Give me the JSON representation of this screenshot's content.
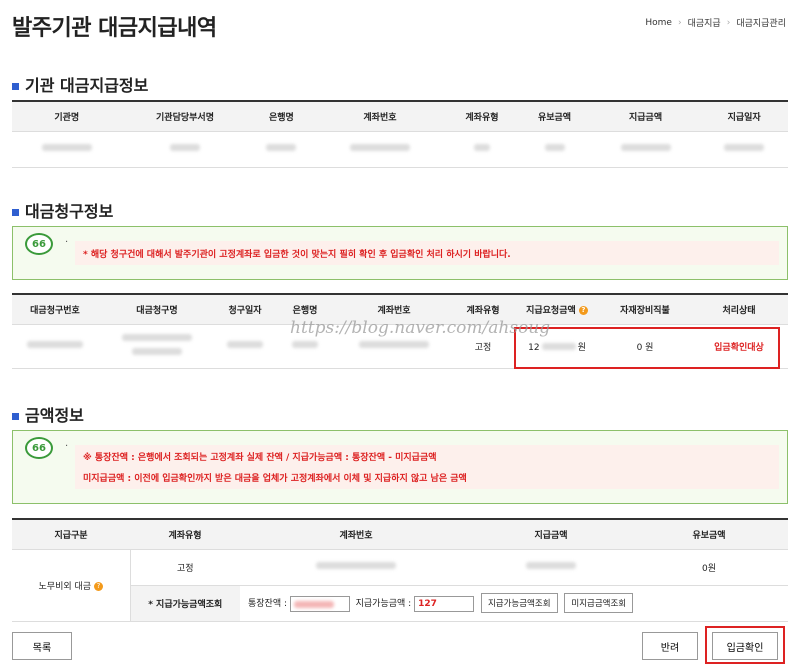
{
  "page_title": "발주기관 대금지급내역",
  "breadcrumb": [
    "Home",
    "대금지급",
    "대금지급관리"
  ],
  "sections": {
    "agency": {
      "title": "기관 대금지급정보",
      "columns": [
        "기관명",
        "기관담당부서명",
        "은행명",
        "계좌번호",
        "계좌유형",
        "유보금액",
        "지급금액",
        "지급일자"
      ]
    },
    "claim": {
      "title": "대금청구정보",
      "notice": "* 해당 청구건에 대해서 발주기관이 고정계좌로 입금한 것이 맞는지 필히 확인 후 입금확인 처리 하시기 바랍니다.",
      "columns": [
        "대금청구번호",
        "대금청구명",
        "청구일자",
        "은행명",
        "계좌번호",
        "계좌유형",
        "지급요청금액",
        "자재장비직불",
        "처리상태"
      ],
      "row": {
        "account_type": "고정",
        "request_amount_prefix": "12",
        "request_amount_suffix": "원",
        "material_direct": "0 원",
        "status": "입금확인대상"
      }
    },
    "amount": {
      "title": "금액정보",
      "notice_line1": "※ 통장잔액 : 은행에서 조회되는 고정계좌 실제 잔액 / 지급가능금액 : 통장잔액 - 미지급금액",
      "notice_line2": "미지급금액 : 이전에 입금확인까지 받은 대금을 업체가 고정계좌에서 이체 및 지급하지 않고 남은 금액",
      "columns": [
        "지급구분",
        "계좌유형",
        "계좌번호",
        "지급금액",
        "유보금액"
      ],
      "category": "노무비외 대금",
      "row": {
        "account_type": "고정",
        "reserve": "0원"
      },
      "inquiry": {
        "label": "* 지급가능금액조회",
        "balance_label": "통장잔액 :",
        "available_label": "지급가능금액 :",
        "available_value": "127",
        "btn_available": "지급가능금액조회",
        "btn_unpaid": "미지급금액조회"
      }
    }
  },
  "buttons": {
    "list": "목록",
    "reject": "반려",
    "confirm": "입금확인"
  },
  "watermark": "https://blog.naver.com/ahsoug"
}
